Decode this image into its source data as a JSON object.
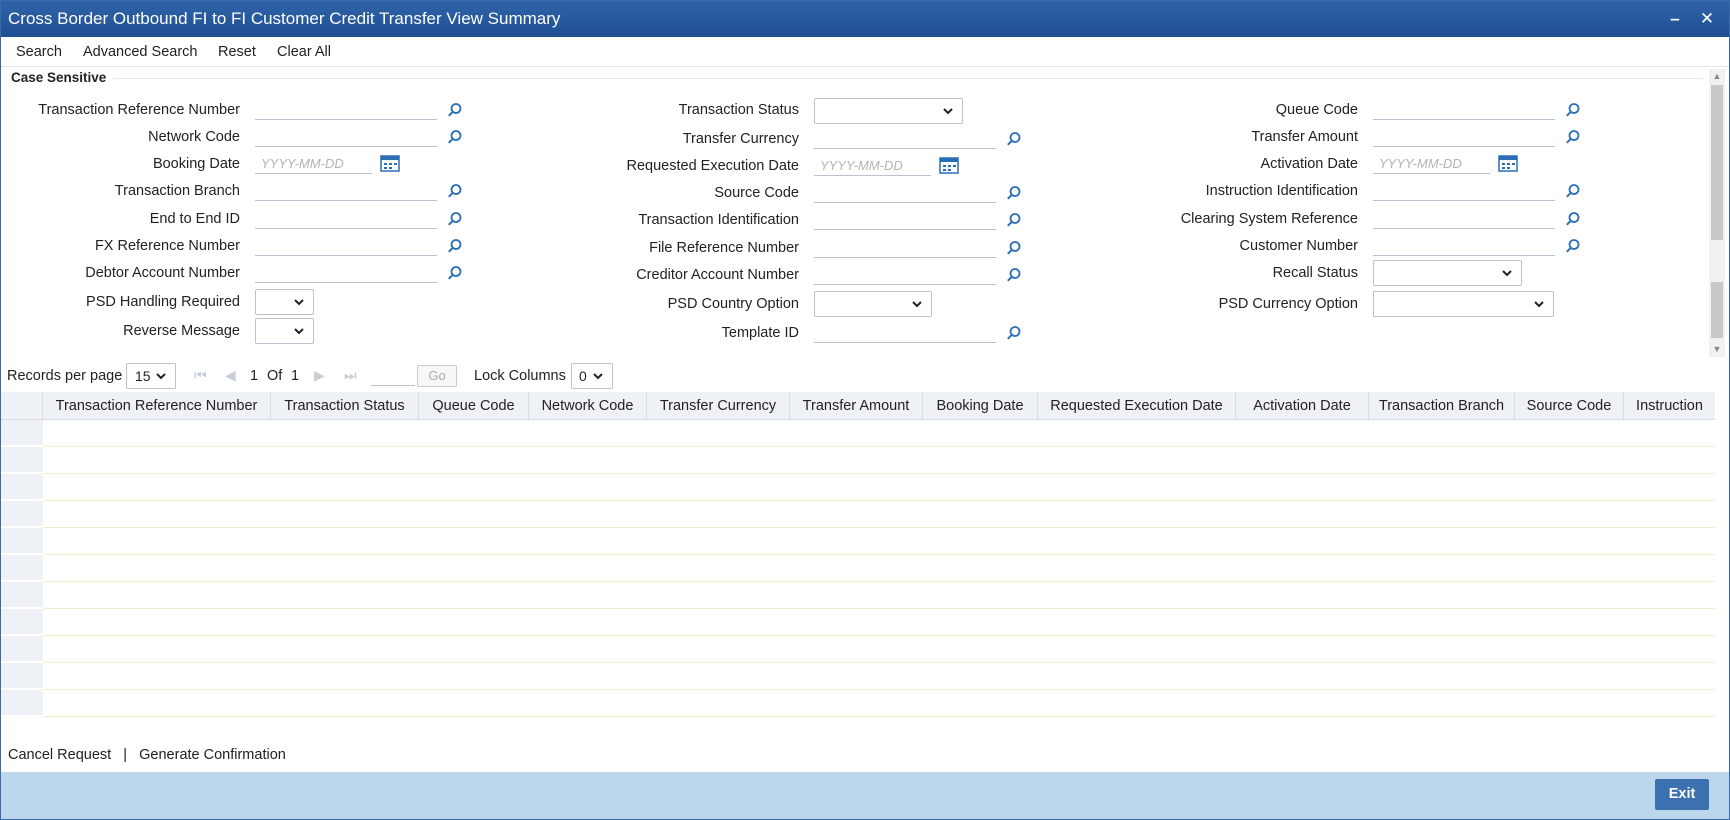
{
  "window": {
    "title": "Cross Border Outbound FI to FI Customer Credit Transfer View Summary"
  },
  "toolbar": {
    "search": "Search",
    "advanced_search": "Advanced Search",
    "reset": "Reset",
    "clear_all": "Clear All"
  },
  "section": {
    "title": "Case Sensitive"
  },
  "form": {
    "col1": {
      "transaction_reference_number": "Transaction Reference Number",
      "network_code": "Network Code",
      "booking_date": "Booking Date",
      "transaction_branch": "Transaction Branch",
      "end_to_end_id": "End to End ID",
      "fx_reference_number": "FX Reference Number",
      "debtor_account_number": "Debtor Account Number",
      "psd_handling_required": "PSD Handling Required",
      "reverse_message": "Reverse Message"
    },
    "col2": {
      "transaction_status": "Transaction Status",
      "transfer_currency": "Transfer Currency",
      "requested_execution_date": "Requested Execution Date",
      "source_code": "Source Code",
      "transaction_identification": "Transaction Identification",
      "file_reference_number": "File Reference Number",
      "creditor_account_number": "Creditor Account Number",
      "psd_country_option": "PSD Country Option",
      "template_id": "Template ID"
    },
    "col3": {
      "queue_code": "Queue Code",
      "transfer_amount": "Transfer Amount",
      "activation_date": "Activation Date",
      "instruction_identification": "Instruction Identification",
      "clearing_system_reference": "Clearing System Reference",
      "customer_number": "Customer Number",
      "recall_status": "Recall Status",
      "psd_currency_option": "PSD Currency Option"
    },
    "date_placeholder": "YYYY-MM-DD"
  },
  "pager": {
    "records_per_page_label": "Records per page",
    "records_per_page_value": "15",
    "current_page": "1",
    "of_label": "Of",
    "total_pages": "1",
    "go_label": "Go",
    "lock_columns_label": "Lock Columns",
    "lock_columns_value": "0"
  },
  "grid": {
    "columns": [
      "Transaction Reference Number",
      "Transaction Status",
      "Queue Code",
      "Network Code",
      "Transfer Currency",
      "Transfer Amount",
      "Booking Date",
      "Requested Execution Date",
      "Activation Date",
      "Transaction Branch",
      "Source Code",
      "Instruction"
    ]
  },
  "footer": {
    "cancel_request": "Cancel Request",
    "separator": "|",
    "generate_confirmation": "Generate Confirmation",
    "exit": "Exit"
  },
  "colors": {
    "title_bar": "#1f4f93",
    "bottom_bar": "#bcd6eb",
    "exit_button": "#3a71ae",
    "grid_header": "#eef1f5"
  },
  "icons": {
    "lookup": "search-icon",
    "calendar": "calendar-icon",
    "dropdown": "chevron-down-icon"
  }
}
